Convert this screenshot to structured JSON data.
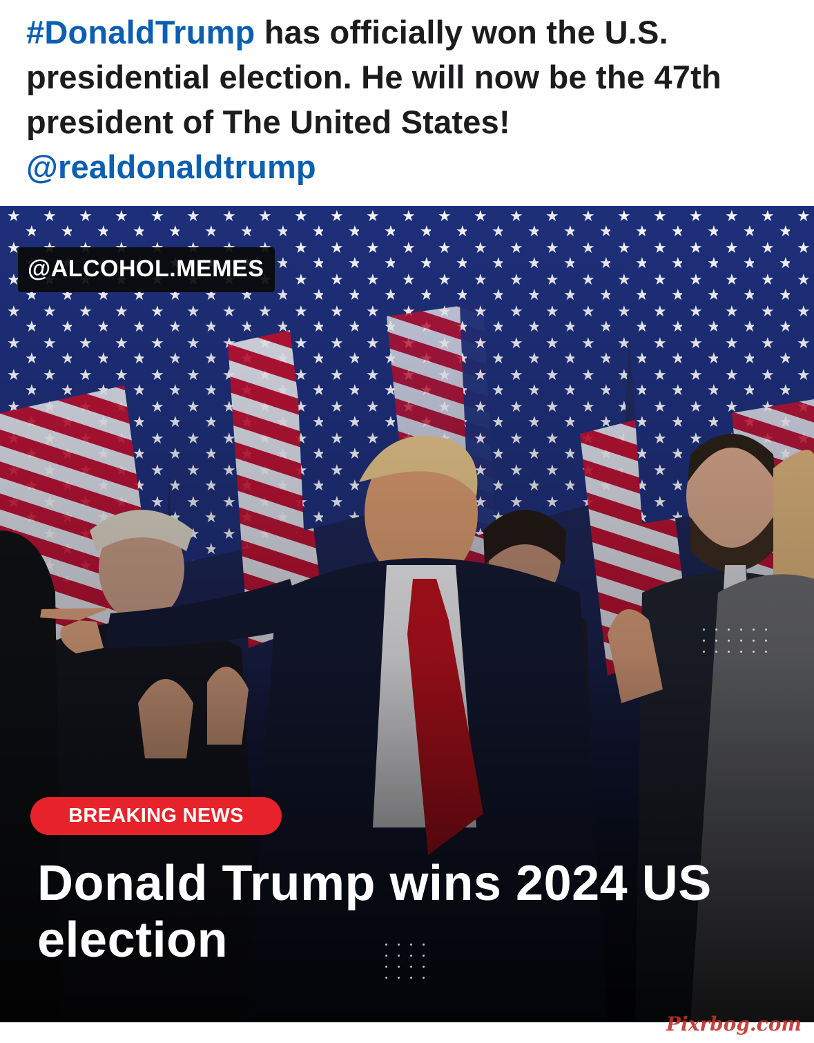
{
  "post": {
    "hashtag": "#DonaldTrump",
    "caption_text": " has officially won the U.S. presidential election. He will now be the 47th president of The United States!",
    "mention": "@realdonaldtrump"
  },
  "image": {
    "source_tag": "@ALCOHOL.MEMES",
    "breaking_label": "BREAKING NEWS",
    "headline": "Donald Trump wins 2024 US election",
    "site_watermark": "Pixrbog.com"
  },
  "colors": {
    "link": "#0b5fb3",
    "breaking_red": "#e8222a",
    "flag_blue": "#1e2f7a",
    "flag_red": "#c8102e"
  }
}
